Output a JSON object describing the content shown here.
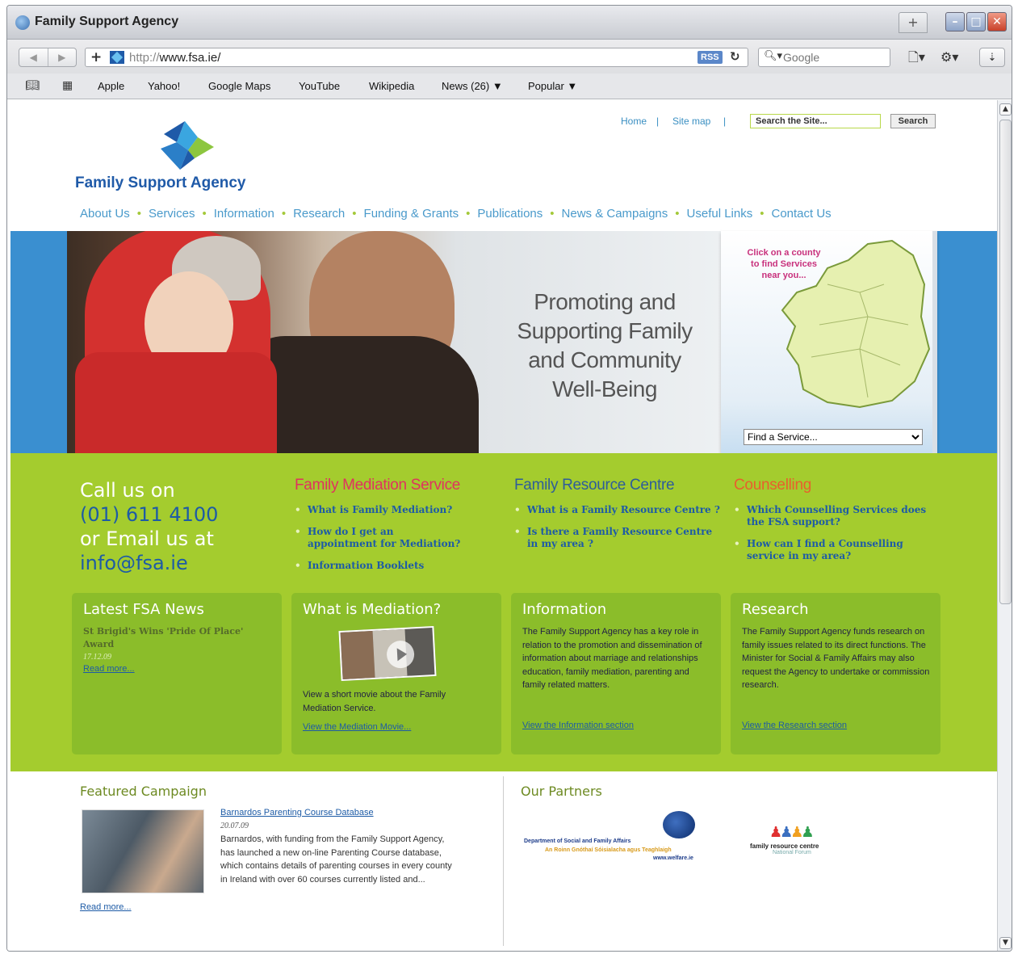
{
  "window": {
    "title": "Family Support Agency"
  },
  "toolbar": {
    "back_label": "◀",
    "forward_label": "▶",
    "url_prefix": "http://",
    "url_host": "www.fsa.ie/",
    "rss_label": "RSS",
    "search_placeholder": "Google"
  },
  "bookmarks": [
    "Apple",
    "Yahoo!",
    "Google Maps",
    "YouTube",
    "Wikipedia",
    "News (26) ▼",
    "Popular ▼"
  ],
  "site": {
    "top_links": {
      "home": "Home",
      "sitemap": "Site map"
    },
    "search_value": "Search the Site...",
    "search_button": "Search",
    "logo_text": "Family Support Agency",
    "nav": [
      "About Us",
      "Services",
      "Information",
      "Research",
      "Funding & Grants",
      "Publications",
      "News & Campaigns",
      "Useful Links",
      "Contact Us"
    ],
    "slogan": [
      "Promoting and",
      "Supporting Family",
      "and Community",
      "Well-Being"
    ],
    "map_hint": [
      "Click on a county",
      "to find Services",
      "near you..."
    ],
    "find_service": "Find a Service...",
    "call": {
      "line1": "Call us on",
      "phone": "(01) 611 4100",
      "line3": "or Email us at",
      "email": "info@fsa.ie"
    },
    "services": [
      {
        "title": "Family Mediation Service",
        "color": "#e0325f",
        "items": [
          "What is Family Mediation?",
          "How do I get an appointment for Mediation?",
          "Information Booklets"
        ]
      },
      {
        "title": "Family Resource Centre",
        "color": "#2e5d9a",
        "items": [
          "What is a Family Resource Centre ?",
          "Is there a Family Resource Centre in my area ?"
        ]
      },
      {
        "title": "Counselling",
        "color": "#e8602c",
        "items": [
          "Which Counselling Services does the FSA support?",
          "How can I find a Counselling service in my area?"
        ]
      }
    ],
    "boxes": {
      "news": {
        "title": "Latest FSA News",
        "headline": "St Brigid's Wins 'Pride Of Place' Award",
        "date": "17.12.09",
        "link": "Read more..."
      },
      "mediation": {
        "title": "What is Mediation?",
        "text": "View a short movie about the Family Mediation Service.",
        "link": "View the Mediation Movie..."
      },
      "information": {
        "title": "Information",
        "text": "The Family Support Agency has a key role in relation to the promotion and dissemination of information about marriage and relationships education, family mediation, parenting and family related matters.",
        "link": "View the Information section"
      },
      "research": {
        "title": "Research",
        "text": "The Family Support Agency funds research on family issues related to its direct functions. The Minister for Social & Family Affairs may also request the Agency to undertake or commission research.",
        "link": "View the Research section"
      }
    },
    "featured": {
      "title": "Featured Campaign",
      "link": "Barnardos Parenting Course Database",
      "date": "20.07.09",
      "body": "Barnardos, with funding from the Family Support Agency, has launched a new on-line Parenting Course database, which contains details of parenting courses in every county in Ireland with over 60 courses currently listed and...",
      "more": "Read more..."
    },
    "partners": {
      "title": "Our Partners",
      "p1_line1": "Department of Social and Family Affairs",
      "p1_line2": "An Roinn Gnóthaí Sóisialacha agus Teaghlaigh",
      "p1_line3": "www.welfare.ie",
      "p2_line1": "family resource centre",
      "p2_line2": "National Forum"
    }
  },
  "colors": {
    "green_band": "#a4cc2e",
    "hero_blue": "#3a8fd0",
    "link_blue": "#1d5ba6",
    "nav_blue": "#4a9acb"
  }
}
